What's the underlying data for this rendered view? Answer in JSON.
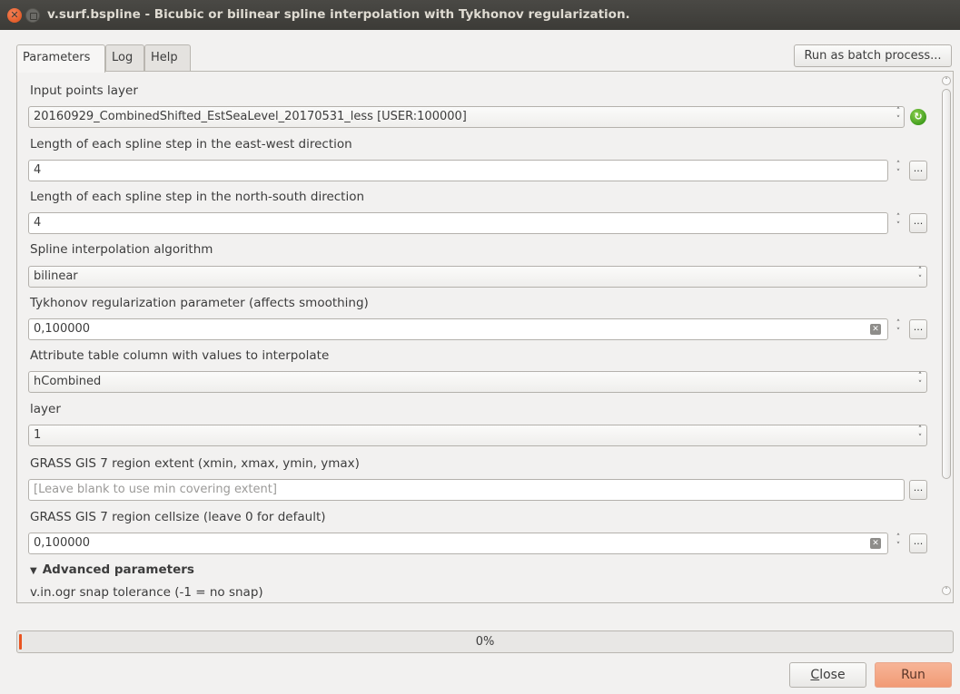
{
  "window": {
    "title": "v.surf.bspline - Bicubic or bilinear spline interpolation with Tykhonov regularization."
  },
  "tabs": [
    {
      "label": "Parameters",
      "active": true
    },
    {
      "label": "Log",
      "active": false
    },
    {
      "label": "Help",
      "active": false
    }
  ],
  "batch_button": "Run as batch process...",
  "params": {
    "input_layer": {
      "label": "Input points layer",
      "value": "20160929_CombinedShifted_EstSeaLevel_20170531_less [USER:100000]"
    },
    "ew_step": {
      "label": "Length of each spline step in the east-west direction",
      "value": "4"
    },
    "ns_step": {
      "label": "Length of each spline step in the north-south direction",
      "value": "4"
    },
    "method": {
      "label": "Spline interpolation algorithm",
      "value": "bilinear"
    },
    "lambda": {
      "label": "Tykhonov regularization parameter (affects smoothing)",
      "value": "0,100000"
    },
    "column": {
      "label": "Attribute table column with values to interpolate",
      "value": "hCombined"
    },
    "layer": {
      "label": "layer",
      "value": "1"
    },
    "region": {
      "label": "GRASS GIS 7 region extent (xmin, xmax, ymin, ymax)",
      "placeholder": "[Leave blank to use min covering extent]"
    },
    "cellsize": {
      "label": "GRASS GIS 7 region cellsize (leave 0 for default)",
      "value": "0,100000"
    }
  },
  "advanced": {
    "label": "Advanced parameters",
    "snap_label": "v.in.ogr snap tolerance (-1 = no snap)"
  },
  "progress": {
    "value": 0,
    "text": "0%"
  },
  "buttons": {
    "close_prefix": "C",
    "close_rest": "lose",
    "run": "Run"
  },
  "icons": {
    "dots": "...",
    "spin_up": "˄",
    "spin_down": "˅",
    "clear": "✕",
    "refresh": "↻",
    "close": "✕"
  },
  "colors": {
    "accent": "#e95420",
    "titlebar": "#3c3b37",
    "run_button": "#f19a75"
  }
}
